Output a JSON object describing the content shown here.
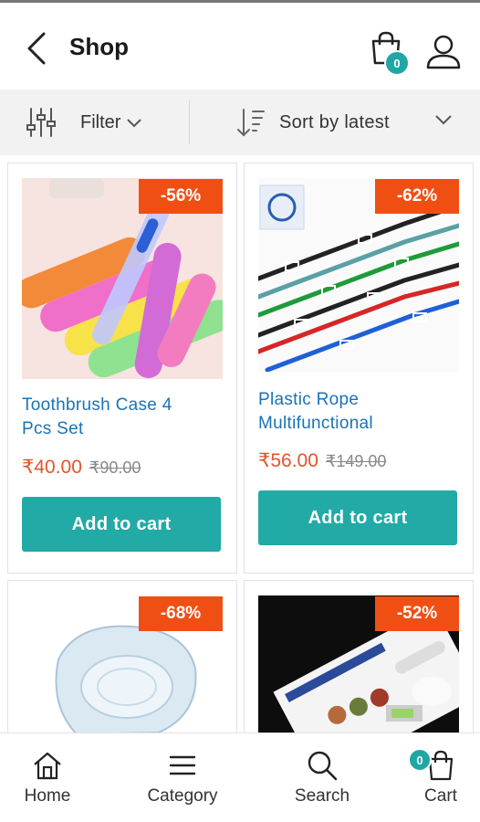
{
  "header": {
    "title": "Shop",
    "bag_count": "0"
  },
  "toolbar": {
    "filter_label": "Filter",
    "sort_label": "Sort by latest"
  },
  "products": [
    {
      "name_line1": "Toothbrush Case 4",
      "name_line2": "Pcs Set",
      "price": "₹40.00",
      "old_price": "₹90.00",
      "discount": "-56%",
      "button_label": "Add to cart"
    },
    {
      "name_line1": "Plastic Rope",
      "name_line2": "Multifunctional",
      "price": "₹56.00",
      "old_price": "₹149.00",
      "discount": "-62%",
      "button_label": "Add to cart"
    },
    {
      "discount": "-68%"
    },
    {
      "discount": "-52%"
    }
  ],
  "bottom_nav": {
    "home_label": "Home",
    "category_label": "Category",
    "search_label": "Search",
    "cart_label": "Cart",
    "cart_count": "0"
  },
  "colors": {
    "accent": "#22aaa6",
    "badge": "#f04f14",
    "price": "#e2542b",
    "link": "#1a73b6"
  },
  "icons": [
    "back-arrow-icon",
    "shopping-bag-icon",
    "user-icon",
    "filter-sliders-icon",
    "chevron-down-icon",
    "sort-icon",
    "home-icon",
    "menu-icon",
    "search-icon",
    "cart-icon"
  ]
}
